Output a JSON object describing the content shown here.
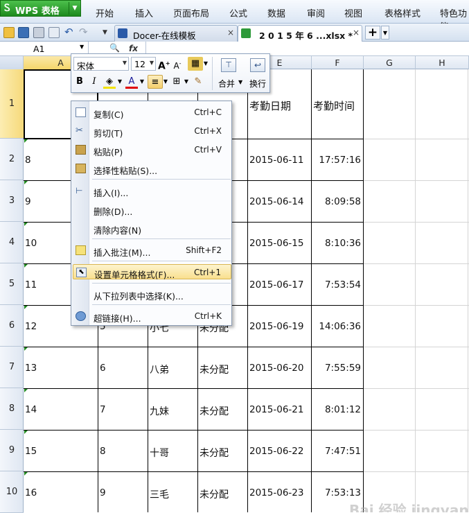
{
  "app": {
    "name": "WPS 表格"
  },
  "menu": [
    "开始",
    "插入",
    "页面布局",
    "公式",
    "数据",
    "审阅",
    "视图",
    "表格样式",
    "特色功能"
  ],
  "tabs": [
    {
      "label": "Docer-在线模板",
      "close": "×"
    },
    {
      "label": "2 0 1 5 年 6 ...xlsx *",
      "close": "×"
    }
  ],
  "new_tab": "+",
  "formula_bar": {
    "cell_ref": "A1",
    "fx": "fx"
  },
  "columns": [
    "A",
    "B",
    "C",
    "D",
    "E",
    "F",
    "G",
    "H"
  ],
  "rows": [
    "1",
    "2",
    "3",
    "4",
    "5",
    "6",
    "7",
    "8",
    "9",
    "10"
  ],
  "header_row": {
    "e": "考勤日期",
    "f": "考勤时间"
  },
  "data_rows": [
    {
      "a": "8",
      "b": "",
      "c": "",
      "d": "",
      "e": "2015-06-11",
      "f": "17:57:16"
    },
    {
      "a": "9",
      "b": "",
      "c": "",
      "d": "",
      "e": "2015-06-14",
      "f": "8:09:58"
    },
    {
      "a": "10",
      "b": "",
      "c": "",
      "d": "",
      "e": "2015-06-15",
      "f": "8:10:36"
    },
    {
      "a": "11",
      "b": "",
      "c": "",
      "d": "",
      "e": "2015-06-17",
      "f": "7:53:54"
    },
    {
      "a": "12",
      "b": "5",
      "c": "小七",
      "d": "未分配",
      "e": "2015-06-19",
      "f": "14:06:36"
    },
    {
      "a": "13",
      "b": "6",
      "c": "八弟",
      "d": "未分配",
      "e": "2015-06-20",
      "f": "7:55:59"
    },
    {
      "a": "14",
      "b": "7",
      "c": "九妹",
      "d": "未分配",
      "e": "2015-06-21",
      "f": "8:01:12"
    },
    {
      "a": "15",
      "b": "8",
      "c": "十哥",
      "d": "未分配",
      "e": "2015-06-22",
      "f": "7:47:51"
    },
    {
      "a": "16",
      "b": "9",
      "c": "三毛",
      "d": "未分配",
      "e": "2015-06-23",
      "f": "7:53:13"
    }
  ],
  "mini_toolbar": {
    "font": "宋体",
    "size": "12",
    "bold": "B",
    "italic": "I",
    "merge": "合并",
    "wrap": "换行"
  },
  "context_menu": [
    {
      "label": "复制(C)",
      "shortcut": "Ctrl+C",
      "icon": "copy-icon"
    },
    {
      "label": "剪切(T)",
      "shortcut": "Ctrl+X",
      "icon": "cut-icon"
    },
    {
      "label": "粘贴(P)",
      "shortcut": "Ctrl+V",
      "icon": "paste-icon"
    },
    {
      "label": "选择性粘贴(S)...",
      "shortcut": "",
      "icon": "paste-special-icon"
    },
    {
      "label": "插入(I)...",
      "shortcut": "",
      "icon": "insert-icon"
    },
    {
      "label": "删除(D)...",
      "shortcut": "",
      "icon": ""
    },
    {
      "label": "清除内容(N)",
      "shortcut": "",
      "icon": ""
    },
    {
      "label": "插入批注(M)...",
      "shortcut": "Shift+F2",
      "icon": "comment-icon"
    },
    {
      "label": "设置单元格格式(F)...",
      "shortcut": "Ctrl+1",
      "icon": "format-cells-icon"
    },
    {
      "label": "从下拉列表中选择(K)...",
      "shortcut": "",
      "icon": ""
    },
    {
      "label": "超链接(H)...",
      "shortcut": "Ctrl+K",
      "icon": "hyperlink-icon"
    }
  ],
  "watermark": "Bai 经验 jingyan.baidu.com",
  "colors": {
    "wps_green": "#2ea52e",
    "highlight": "#f9df8e",
    "row1_header": "#fbe58b"
  }
}
